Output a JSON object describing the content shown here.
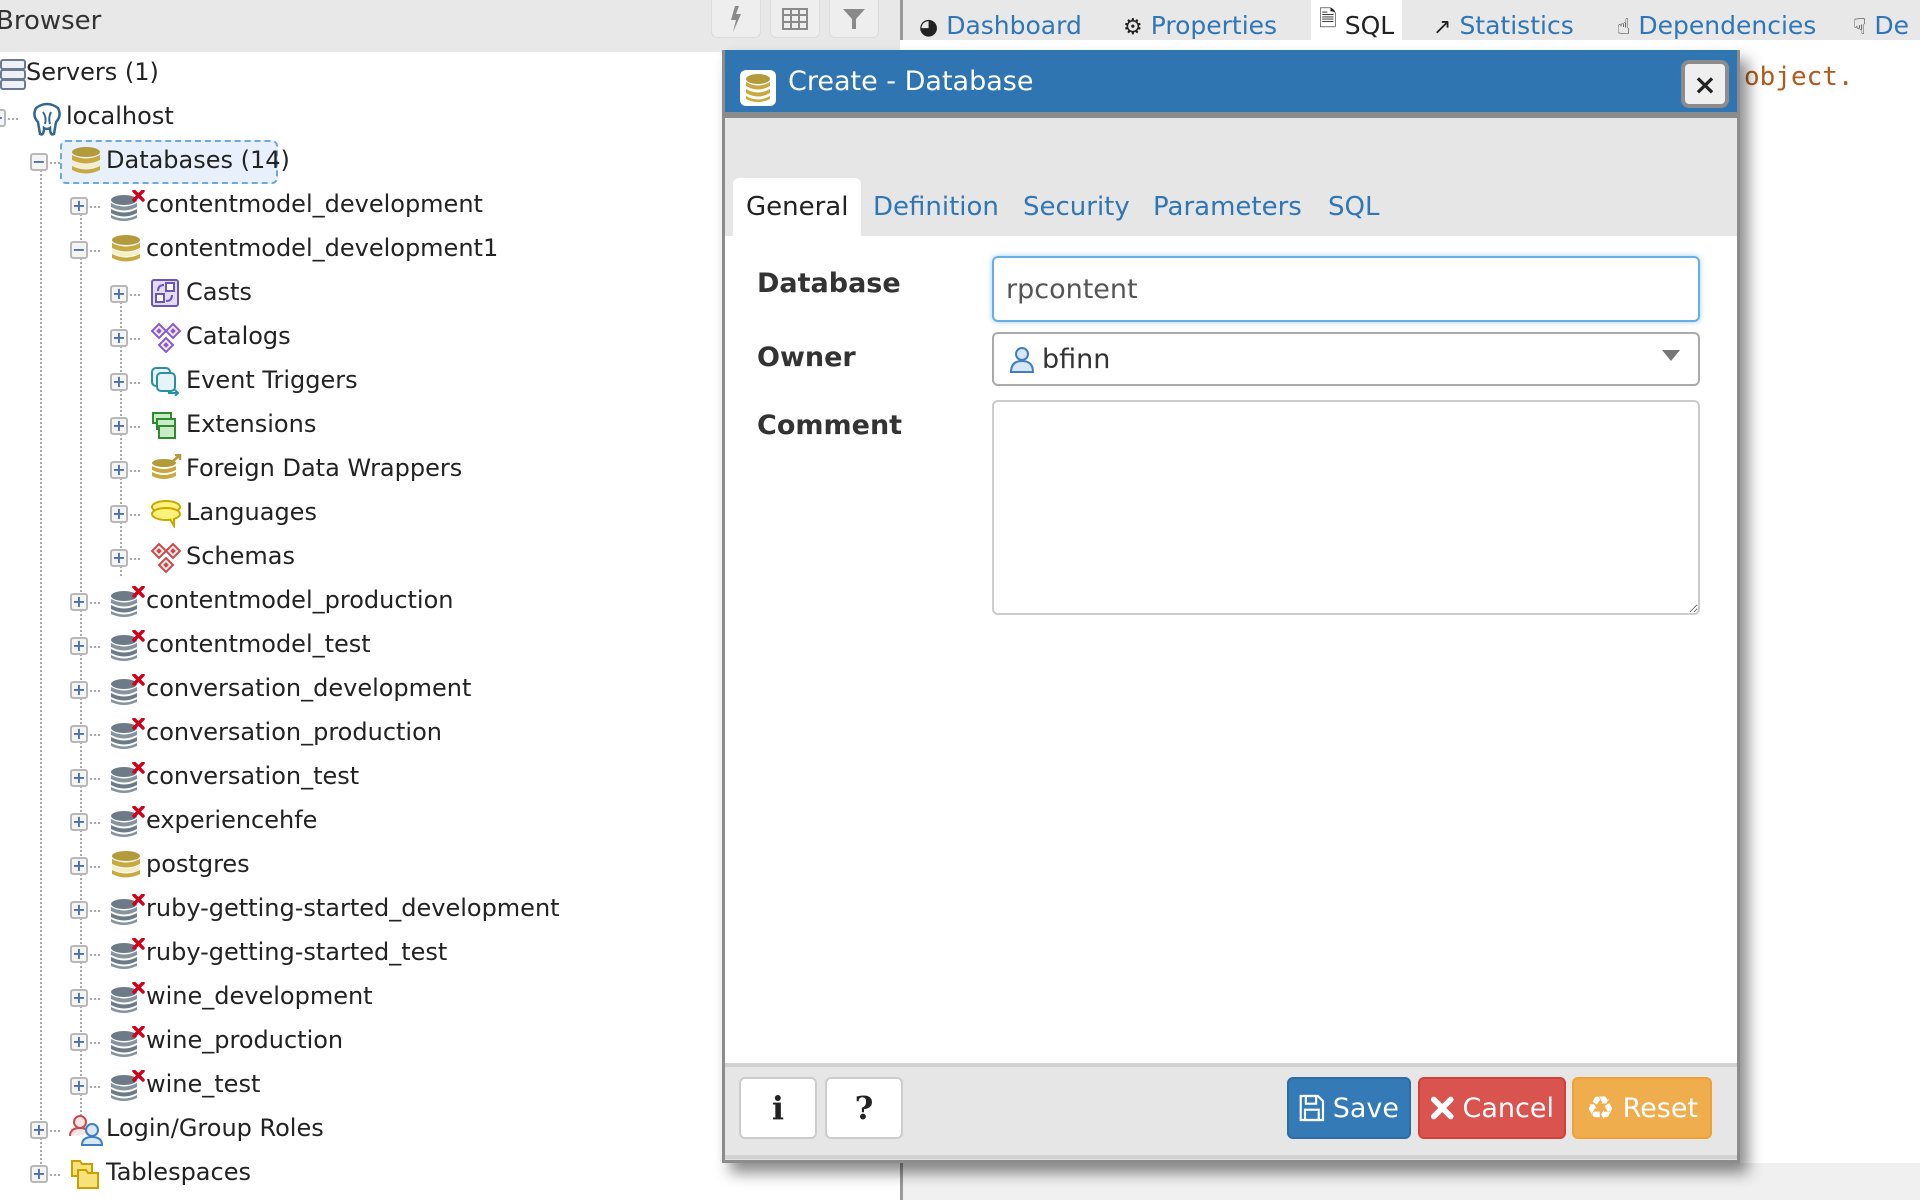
{
  "browser": {
    "title": "Browser",
    "toolbar": [
      {
        "name": "query-tool",
        "icon": "lightning-icon"
      },
      {
        "name": "view-data",
        "icon": "table-icon"
      },
      {
        "name": "filter",
        "icon": "filter-icon"
      }
    ]
  },
  "tree": {
    "servers": "Servers (1)",
    "server": "localhost",
    "databases_group": "Databases (14)",
    "databases": [
      {
        "label": "contentmodel_development",
        "connected": false,
        "expanded": false
      },
      {
        "label": "contentmodel_development1",
        "connected": true,
        "expanded": true
      },
      {
        "label": "contentmodel_production",
        "connected": false,
        "expanded": false
      },
      {
        "label": "contentmodel_test",
        "connected": false,
        "expanded": false
      },
      {
        "label": "conversation_development",
        "connected": false,
        "expanded": false
      },
      {
        "label": "conversation_production",
        "connected": false,
        "expanded": false
      },
      {
        "label": "conversation_test",
        "connected": false,
        "expanded": false
      },
      {
        "label": "experiencehfe",
        "connected": false,
        "expanded": false
      },
      {
        "label": "postgres",
        "connected": true,
        "expanded": false
      },
      {
        "label": "ruby-getting-started_development",
        "connected": false,
        "expanded": false
      },
      {
        "label": "ruby-getting-started_test",
        "connected": false,
        "expanded": false
      },
      {
        "label": "wine_development",
        "connected": false,
        "expanded": false
      },
      {
        "label": "wine_production",
        "connected": false,
        "expanded": false
      },
      {
        "label": "wine_test",
        "connected": false,
        "expanded": false
      }
    ],
    "db_children": [
      {
        "label": "Casts",
        "icon": "casts-icon"
      },
      {
        "label": "Catalogs",
        "icon": "catalogs-icon"
      },
      {
        "label": "Event Triggers",
        "icon": "event-triggers-icon"
      },
      {
        "label": "Extensions",
        "icon": "extensions-icon"
      },
      {
        "label": "Foreign Data Wrappers",
        "icon": "foreign-data-wrappers-icon"
      },
      {
        "label": "Languages",
        "icon": "languages-icon"
      },
      {
        "label": "Schemas",
        "icon": "schemas-icon"
      }
    ],
    "login_roles": "Login/Group Roles",
    "tablespaces": "Tablespaces"
  },
  "main_tabs": [
    {
      "label": "Dashboard",
      "icon": "dashboard-icon",
      "active": false
    },
    {
      "label": "Properties",
      "icon": "properties-icon",
      "active": false
    },
    {
      "label": "SQL",
      "icon": "sql-file-icon",
      "active": true
    },
    {
      "label": "Statistics",
      "icon": "statistics-icon",
      "active": false
    },
    {
      "label": "Dependencies",
      "icon": "dependencies-icon",
      "active": false
    },
    {
      "label": "De",
      "icon": "dependents-icon",
      "active": false
    }
  ],
  "sql_pane_text": "object.",
  "dialog": {
    "title": "Create - Database",
    "close_label": "×",
    "tabs": [
      {
        "label": "General",
        "active": true
      },
      {
        "label": "Definition",
        "active": false
      },
      {
        "label": "Security",
        "active": false
      },
      {
        "label": "Parameters",
        "active": false
      },
      {
        "label": "SQL",
        "active": false
      }
    ],
    "fields": {
      "database_label": "Database",
      "database_value": "rpcontent",
      "owner_label": "Owner",
      "owner_value": "bfinn",
      "comment_label": "Comment",
      "comment_value": ""
    },
    "footer": {
      "info_label": "i",
      "help_label": "?",
      "save_label": "Save",
      "cancel_label": "Cancel",
      "reset_label": "Reset"
    }
  },
  "colors": {
    "primary": "#337ab7",
    "danger": "#d9534f",
    "warning": "#f0ad4e",
    "header_blue": "#2f75b2",
    "link_blue": "#2f76b6",
    "db_gold": "#c9a93f",
    "db_grey": "#6d7a88",
    "disconnected_red": "#d0021b"
  }
}
